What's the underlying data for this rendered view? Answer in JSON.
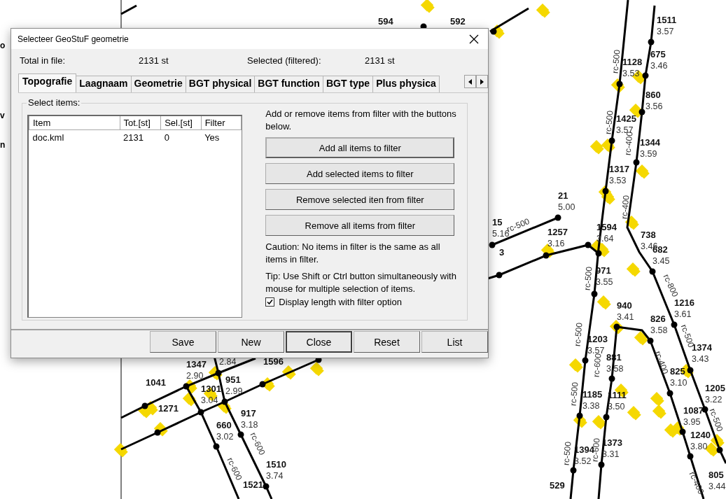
{
  "map": {
    "left_fragments": [
      "o",
      "v",
      "n"
    ],
    "nodes": [
      {
        "id": "594"
      },
      {
        "id": "592"
      },
      {
        "id": "1511",
        "value": "3.57"
      },
      {
        "id": "1128",
        "value": "3.53"
      },
      {
        "id": "675",
        "value": "3.46"
      },
      {
        "id": "860",
        "value": "3.56"
      },
      {
        "id": "1425",
        "value": "3.57"
      },
      {
        "id": "1344",
        "value": "3.59"
      },
      {
        "id": "1317",
        "value": "3.53"
      },
      {
        "id": "21",
        "value": "5.00"
      },
      {
        "id": "15",
        "value": "5.16"
      },
      {
        "id": "1257",
        "value": "3.16"
      },
      {
        "id": "1594",
        "value": "3.64"
      },
      {
        "id": "738",
        "value": "3.46"
      },
      {
        "id": "682",
        "value": "3.45"
      },
      {
        "id": "3"
      },
      {
        "id": "971",
        "value": "3.55"
      },
      {
        "id": "940",
        "value": "3.41"
      },
      {
        "id": "826",
        "value": "3.58"
      },
      {
        "id": "1216",
        "value": "3.61"
      },
      {
        "id": "1203",
        "value": "3.57"
      },
      {
        "id": "881",
        "value": "3.58"
      },
      {
        "id": "1374",
        "value": "3.43"
      },
      {
        "id": "825",
        "value": "3.10"
      },
      {
        "id": "1205",
        "value": "3.22"
      },
      {
        "id": "1185",
        "value": "3.38"
      },
      {
        "id": "1111",
        "value": "3.50"
      },
      {
        "id": "1087",
        "value": "3.95"
      },
      {
        "id": "1240",
        "value": "3.80"
      },
      {
        "id": "1373",
        "value": "3.31"
      },
      {
        "id": "1394",
        "value": "3.52"
      },
      {
        "id": "529"
      },
      {
        "id": "805",
        "value": "3.44"
      },
      {
        "id": "1347",
        "value": "2.90"
      },
      {
        "value": "2.84"
      },
      {
        "id": "1596"
      },
      {
        "id": "951",
        "value": "2.99"
      },
      {
        "id": "1041"
      },
      {
        "id": "1301",
        "value": "3.04"
      },
      {
        "id": "1271"
      },
      {
        "id": "917",
        "value": "3.18"
      },
      {
        "id": "660",
        "value": "3.02"
      },
      {
        "id": "1510",
        "value": "3.74"
      },
      {
        "id": "1521"
      }
    ],
    "pipes": [
      "rc-500",
      "rc-500",
      "rc-400",
      "rc-400",
      "rc-500",
      "rc-500",
      "rc-800",
      "rc-500",
      "rc-600",
      "rc-400",
      "rc-500",
      "rc-500",
      "rc-500",
      "rc-500",
      "rc-600",
      "rc-400",
      "rc-600",
      "rc-600"
    ]
  },
  "dialog": {
    "title": "Selecteer GeoStuF geometrie",
    "summary": [
      {
        "label": "Total in file:",
        "value": "2131 st"
      },
      {
        "label": "Selected (filtered):",
        "value": "2131 st"
      }
    ],
    "tabs": [
      {
        "label": "Topografie",
        "selected": true
      },
      {
        "label": "Laagnaam",
        "selected": false
      },
      {
        "label": "Geometrie",
        "selected": false
      },
      {
        "label": "BGT physical",
        "selected": false
      },
      {
        "label": "BGT function",
        "selected": false
      },
      {
        "label": "BGT type",
        "selected": false
      },
      {
        "label": "Plus physica",
        "selected": false
      }
    ],
    "group": {
      "title": "Select items:",
      "columns": [
        "Item",
        "Tot.[st]",
        "Sel.[st]",
        "Filter"
      ],
      "rows": [
        [
          "doc.kml",
          "2131",
          "0",
          "Yes"
        ]
      ],
      "instructions": "Add or remove items from filter with the buttons below.",
      "actions": [
        "Add all items to filter",
        "Add selected items to filter",
        "Remove selected iten from filter",
        "Remove all items from filter"
      ],
      "caution": "Caution: No items in filter is the same as all items in filter.",
      "tip": "Tip: Use Shift or Ctrl button simultaneously with mouse for multiple selection of items.",
      "option": {
        "label": "Display length with filter option",
        "checked": true
      }
    },
    "buttons": [
      {
        "label": "Save",
        "default": false
      },
      {
        "label": "New",
        "default": false
      },
      {
        "label": "Close",
        "default": true
      },
      {
        "label": "Reset",
        "default": false
      },
      {
        "label": "List",
        "default": false
      }
    ]
  }
}
